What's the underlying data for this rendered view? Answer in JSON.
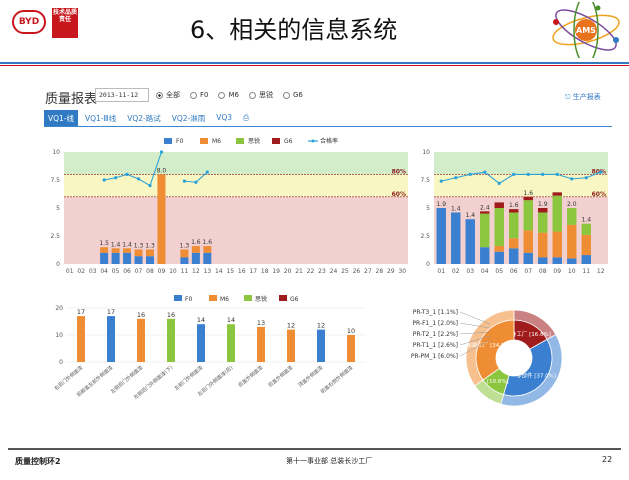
{
  "slide": {
    "title": "6、相关的信息系统",
    "logo_text": "BYD",
    "tag_text": "技术品质责任",
    "ams_text": "AMS"
  },
  "report": {
    "title": "质量报表",
    "date_value": "2013-11-12",
    "radio_options": [
      "全部",
      "F0",
      "M6",
      "思锐",
      "G6"
    ],
    "radio_selected": "全部",
    "export_label": "生产报表"
  },
  "tabs": [
    {
      "label": "VQ1-线",
      "active": true
    },
    {
      "label": "VQ1-Ⅲ线",
      "active": false
    },
    {
      "label": "VQ2-路试",
      "active": false
    },
    {
      "label": "VQ2-淋雨",
      "active": false
    },
    {
      "label": "VQ3",
      "active": false
    }
  ],
  "colors": {
    "F0": "#3a7fd0",
    "M6": "#ef8d35",
    "思锐": "#8cc63f",
    "G6": "#a01c1c",
    "rate": "#2aa2d9",
    "band_green": "#d3ecc9",
    "band_yellow": "#f8f6c2",
    "band_red": "#f2d0d0",
    "threshold": "#8b1a1a"
  },
  "chart_data": [
    {
      "type": "bar",
      "stacked": true,
      "legend": [
        "F0",
        "M6",
        "思锐",
        "G6",
        "合格率"
      ],
      "categories": [
        "01",
        "02",
        "03",
        "04",
        "05",
        "06",
        "07",
        "08",
        "09",
        "10",
        "11",
        "12",
        "13",
        "14",
        "15",
        "16",
        "17",
        "18",
        "19",
        "20",
        "21",
        "22",
        "23",
        "24",
        "25",
        "26",
        "27",
        "28",
        "29",
        "30"
      ],
      "ylim": [
        0,
        10
      ],
      "yticks": [
        "0",
        "2.5",
        "5",
        "7.5",
        "10"
      ],
      "thresholds": [
        {
          "label": "80%",
          "value": 8
        },
        {
          "label": "60%",
          "value": 6
        }
      ],
      "series": [
        {
          "name": "F0",
          "values": [
            0,
            0,
            0,
            1,
            1,
            1,
            0.7,
            0.7,
            0,
            0,
            0.6,
            1,
            1,
            0,
            0,
            0,
            0,
            0,
            0,
            0,
            0,
            0,
            0,
            0,
            0,
            0,
            0,
            0,
            0,
            0
          ]
        },
        {
          "name": "M6",
          "values": [
            0,
            0,
            0,
            0.5,
            0.4,
            0.4,
            0.6,
            0.6,
            8,
            0,
            0.7,
            0.6,
            0.6,
            0,
            0,
            0,
            0,
            0,
            0,
            0,
            0,
            0,
            0,
            0,
            0,
            0,
            0,
            0,
            0,
            0
          ]
        }
      ],
      "totals_labels": [
        "",
        "",
        "",
        "1.5",
        "1.4",
        "1.4",
        "1.3",
        "1.3",
        "8.0",
        "",
        "1.3",
        "1.6",
        "1.6",
        "",
        "",
        "",
        "",
        "",
        "",
        "",
        "",
        "",
        "",
        "",
        "",
        "",
        "",
        "",
        "",
        ""
      ],
      "rate": [
        null,
        null,
        null,
        7.5,
        7.7,
        8.0,
        7.6,
        7.0,
        10,
        null,
        7.4,
        7.3,
        8.2,
        null,
        null,
        null,
        null,
        null,
        null,
        null,
        null,
        null,
        null,
        null,
        null,
        null,
        null,
        null,
        null,
        null
      ]
    },
    {
      "type": "bar",
      "stacked": true,
      "categories": [
        "01",
        "02",
        "03",
        "04",
        "05",
        "06",
        "07",
        "08",
        "09",
        "10",
        "11",
        "12"
      ],
      "ylim": [
        0,
        10
      ],
      "yticks": [
        "0",
        "2.5",
        "5",
        "7.5",
        "10"
      ],
      "thresholds": [
        {
          "label": "80%",
          "value": 8
        },
        {
          "label": "60%",
          "value": 6
        }
      ],
      "series": [
        {
          "name": "F0",
          "values": [
            5.0,
            4.6,
            4.0,
            1.5,
            1.1,
            1.4,
            1.0,
            0.6,
            0.6,
            0.5,
            0.8,
            0
          ]
        },
        {
          "name": "M6",
          "values": [
            0,
            0,
            0,
            0,
            0.5,
            0.9,
            2.0,
            2.2,
            2.3,
            3.0,
            1.8,
            0
          ]
        },
        {
          "name": "思锐",
          "values": [
            0,
            0,
            0,
            3.0,
            3.4,
            2.3,
            2.7,
            1.8,
            3.2,
            1.5,
            1.0,
            0
          ]
        },
        {
          "name": "G6",
          "values": [
            0,
            0,
            0,
            0.2,
            0.5,
            0.3,
            0.3,
            0.4,
            0.3,
            0,
            0,
            0
          ]
        }
      ],
      "totals_labels": [
        "1.9",
        "1.4",
        "1.4",
        "2.4",
        "",
        "1.6",
        "1.6",
        "1.9",
        "",
        "2.0",
        "1.4",
        ""
      ],
      "rate": [
        7.4,
        7.7,
        8.0,
        8.2,
        7.2,
        8.0,
        8.0,
        8.0,
        8.0,
        7.6,
        7.7,
        8.2
      ]
    },
    {
      "type": "bar",
      "legend": [
        "F0",
        "M6",
        "思锐",
        "G6"
      ],
      "ylim": [
        0,
        20
      ],
      "yticks": [
        "0",
        "10",
        "20"
      ],
      "values": [
        17,
        17,
        16,
        16,
        14,
        14,
        13,
        12,
        12,
        10
      ],
      "bar_series": [
        "M6",
        "F0",
        "M6",
        "思锐",
        "F0",
        "思锐",
        "M6",
        "M6",
        "F0",
        "M6"
      ],
      "categories": [
        "右后门外侧面漆",
        "前舱盖左前外侧面漆",
        "左侧后门外侧面漆",
        "左侧后门外侧面漆(下)",
        "左前门外侧面漆",
        "左后门外侧面漆(后)",
        "后盖外侧面漆",
        "后盖外侧面漆",
        "顶盖外侧面漆",
        "前盖右侧外侧面漆"
      ]
    },
    {
      "type": "pie",
      "inner": [
        {
          "label": "车身工厂",
          "value": 16.6,
          "color": "#a01c1c"
        },
        {
          "label": "零部件",
          "value": 37.0,
          "color": "#3a7fd0"
        },
        {
          "label": "",
          "value": 10.6,
          "color": "#8cc63f"
        },
        {
          "label": "涂装工厂",
          "value": 34.3,
          "color": "#ef8d35"
        }
      ],
      "inner_labels": [
        "车身工厂 [16.6%]",
        "零部件 [37.0%]",
        "[10.6%]",
        "涂装工厂 [34.3%]"
      ],
      "outer_labels": [
        "PR-T3_1 [1.1%]",
        "PR-F1_1 [2.0%]",
        "PR-T2_1 [2.2%]",
        "PR-T1_1 [2.6%]",
        "PR-PM_1 [6.0%]"
      ]
    }
  ],
  "footer": {
    "left": "质量控制环2",
    "mid": "第十一事业部 总装长沙工厂",
    "page": "22"
  }
}
